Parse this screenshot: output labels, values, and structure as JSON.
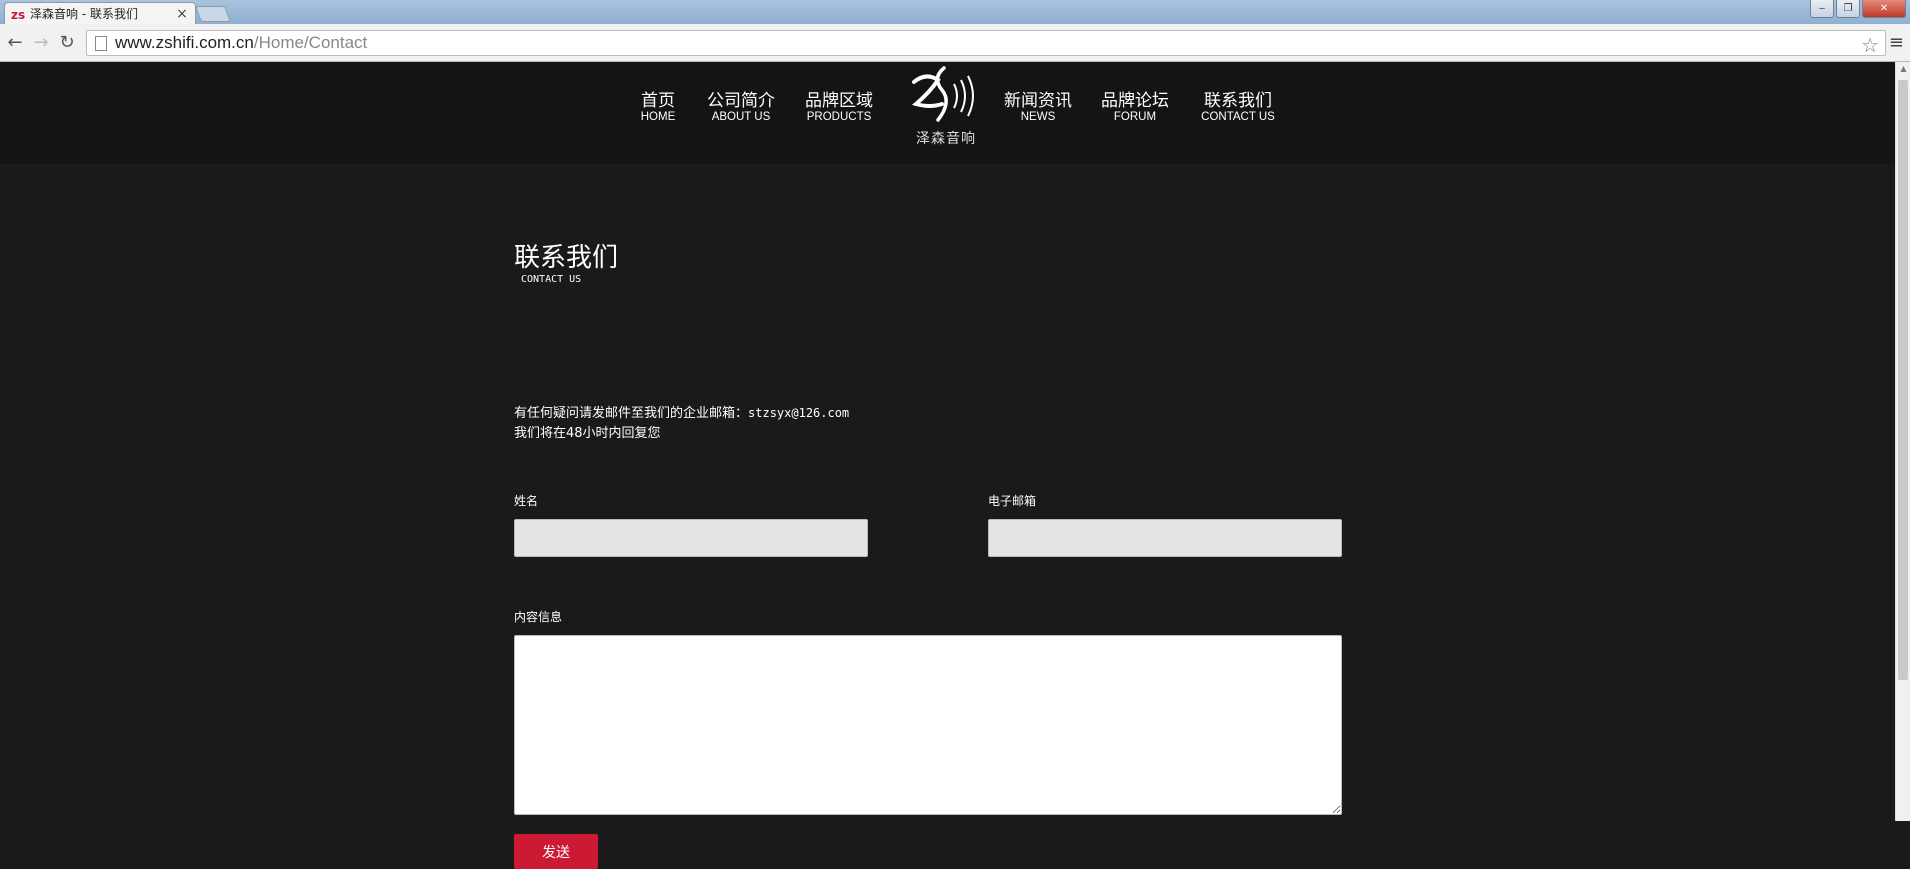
{
  "browser": {
    "tab_title": "泽森音响 - 联系我们",
    "tab_close": "×",
    "url_host": "www.zshifi.com.cn",
    "url_path": "/Home/Contact",
    "back_glyph": "←",
    "forward_glyph": "→",
    "reload_glyph": "↻",
    "star_glyph": "☆",
    "menu_glyph": "≡",
    "min_glyph": "‒",
    "max_glyph": "❐",
    "close_glyph": "✕"
  },
  "nav": {
    "items": [
      {
        "zh": "首页",
        "en": "HOME"
      },
      {
        "zh": "公司简介",
        "en": "ABOUT US"
      },
      {
        "zh": "品牌区域",
        "en": "PRODUCTS"
      },
      {
        "zh": "新闻资讯",
        "en": "NEWS"
      },
      {
        "zh": "品牌论坛",
        "en": "FORUM"
      },
      {
        "zh": "联系我们",
        "en": "CONTACT US"
      }
    ],
    "logo_text": "泽森音响"
  },
  "page": {
    "title": "联系我们",
    "subtitle": "CONTACT US",
    "info_line1_prefix": "有任何疑问请发邮件至我们的企业邮箱：",
    "info_email": "stzsyx@126.com",
    "info_line2": "我们将在48小时内回复您"
  },
  "form": {
    "name_label": "姓名",
    "email_label": "电子邮箱",
    "content_label": "内容信息",
    "name_value": "",
    "email_value": "",
    "content_value": "",
    "submit_label": "发送"
  },
  "colors": {
    "background": "#1a1a1a",
    "header": "#141414",
    "accent": "#cc1a35",
    "field": "#e4e4e4"
  }
}
